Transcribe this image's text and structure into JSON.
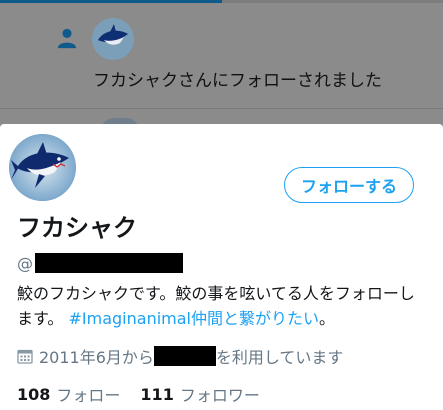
{
  "notification": {
    "text": "フカシャクさんにフォローされました",
    "icon": "person-icon"
  },
  "profile": {
    "display_name": "フカシャク",
    "handle_prefix": "@",
    "follow_button_label": "フォローする",
    "bio_text": "鮫のフカシャクです。鮫の事を呟いてる人をフォローします。 ",
    "bio_hashtag": "#Imaginanimal仲間と繋がりたい",
    "bio_suffix": "。",
    "joined_prefix": "2011年6月から",
    "joined_suffix": "を利用しています",
    "following_count": "108",
    "following_label": "フォロー",
    "followers_count": "111",
    "followers_label": "フォロワー"
  },
  "colors": {
    "accent": "#1da1f2",
    "secondary_text": "#657786",
    "overlay": "#8b8b8b"
  }
}
